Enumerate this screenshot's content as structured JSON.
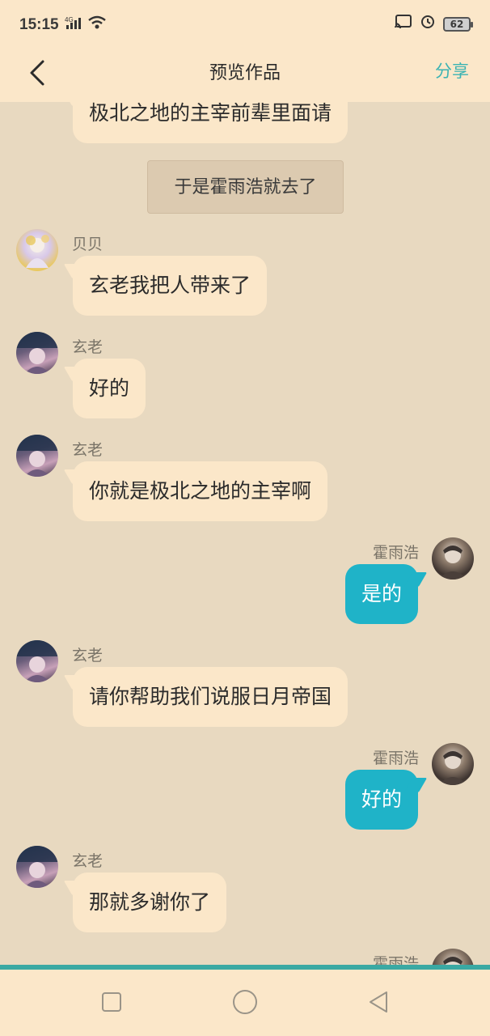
{
  "status_bar": {
    "time": "15:15",
    "network": "4G",
    "battery": "62",
    "icons": [
      "signal-icon",
      "wifi-icon",
      "cast-icon",
      "alarm-icon",
      "battery-icon"
    ]
  },
  "header": {
    "back_icon": "chevron-left-icon",
    "title": "预览作品",
    "share_label": "分享",
    "accent_color": "#3bb3b3"
  },
  "messages": [
    {
      "type": "left",
      "speaker": "",
      "text": "极北之地的主宰前辈里面请"
    },
    {
      "type": "narration",
      "text": "于是霍雨浩就去了"
    },
    {
      "type": "left",
      "speaker": "贝贝",
      "text": "玄老我把人带来了"
    },
    {
      "type": "left",
      "speaker": "玄老",
      "text": "好的"
    },
    {
      "type": "left",
      "speaker": "玄老",
      "text": "你就是极北之地的主宰啊"
    },
    {
      "type": "right",
      "speaker": "霍雨浩",
      "text": "是的"
    },
    {
      "type": "left",
      "speaker": "玄老",
      "text": "请你帮助我们说服日月帝国"
    },
    {
      "type": "right",
      "speaker": "霍雨浩",
      "text": "好的"
    },
    {
      "type": "left",
      "speaker": "玄老",
      "text": "那就多谢你了"
    },
    {
      "type": "right",
      "speaker": "霍雨浩",
      "text": ""
    }
  ],
  "colors": {
    "background": "#e8d9c0",
    "bubble_left": "#fbe7c9",
    "bubble_right": "#1fb3c8"
  },
  "navbar": {
    "icons": [
      "square-recent-icon",
      "circle-home-icon",
      "triangle-back-icon"
    ]
  }
}
